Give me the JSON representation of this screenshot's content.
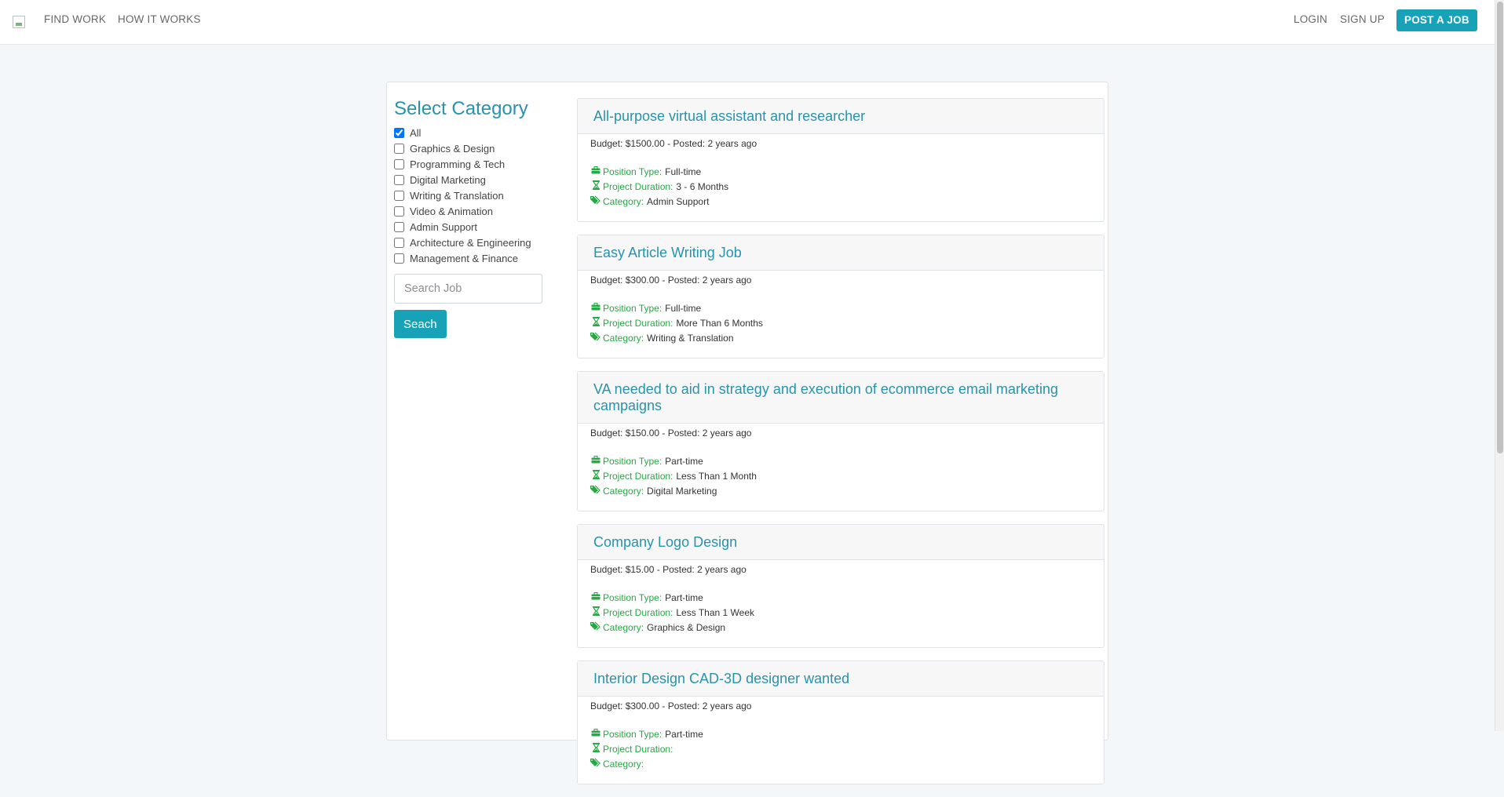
{
  "nav": {
    "find_work": "FIND WORK",
    "how_it_works": "HOW IT WORKS",
    "login": "LOGIN",
    "sign_up": "SIGN UP",
    "post_job": "POST A JOB"
  },
  "sidebar": {
    "title": "Select Category",
    "categories": [
      {
        "label": "All",
        "checked": true
      },
      {
        "label": "Graphics & Design",
        "checked": false
      },
      {
        "label": "Programming & Tech",
        "checked": false
      },
      {
        "label": "Digital Marketing",
        "checked": false
      },
      {
        "label": "Writing & Translation",
        "checked": false
      },
      {
        "label": "Video & Animation",
        "checked": false
      },
      {
        "label": "Admin Support",
        "checked": false
      },
      {
        "label": "Architecture & Engineering",
        "checked": false
      },
      {
        "label": "Management & Finance",
        "checked": false
      }
    ],
    "search_placeholder": "Search Job",
    "search_value": "",
    "search_button": "Seach"
  },
  "labels": {
    "position_type": "Position Type:",
    "project_duration": "Project Duration:",
    "category": "Category:"
  },
  "jobs": [
    {
      "title": "All-purpose virtual assistant and researcher",
      "meta": "Budget: $1500.00 - Posted: 2 years ago",
      "position_type": "Full-time",
      "project_duration": "3 - 6 Months",
      "category": "Admin Support"
    },
    {
      "title": "Easy Article Writing Job",
      "meta": "Budget: $300.00 - Posted: 2 years ago",
      "position_type": "Full-time",
      "project_duration": "More Than 6 Months",
      "category": "Writing & Translation"
    },
    {
      "title": "VA needed to aid in strategy and execution of ecommerce email marketing campaigns",
      "meta": "Budget: $150.00 - Posted: 2 years ago",
      "position_type": "Part-time",
      "project_duration": "Less Than 1 Month",
      "category": "Digital Marketing"
    },
    {
      "title": "Company Logo Design",
      "meta": "Budget: $15.00 - Posted: 2 years ago",
      "position_type": "Part-time",
      "project_duration": "Less Than 1 Week",
      "category": "Graphics & Design"
    },
    {
      "title": "Interior Design CAD-3D designer wanted",
      "meta": "Budget: $300.00 - Posted: 2 years ago",
      "position_type": "Part-time",
      "project_duration": "",
      "category": ""
    }
  ],
  "colors": {
    "accent": "#17a2b8",
    "title": "#2893ab",
    "label_green": "#28a745"
  },
  "icons": {
    "position_type": "briefcase-icon",
    "project_duration": "hourglass-icon",
    "category": "tags-icon"
  }
}
